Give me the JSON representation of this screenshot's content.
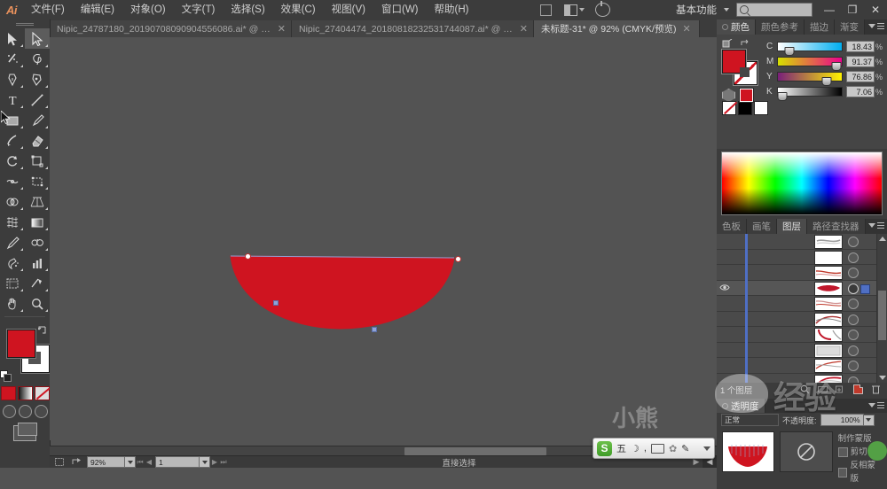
{
  "app": {
    "name": "Adobe Illustrator",
    "logo": "Ai"
  },
  "menubar": {
    "items": [
      {
        "label": "文件(F)",
        "name": "menu-file"
      },
      {
        "label": "编辑(E)",
        "name": "menu-edit"
      },
      {
        "label": "对象(O)",
        "name": "menu-object"
      },
      {
        "label": "文字(T)",
        "name": "menu-type"
      },
      {
        "label": "选择(S)",
        "name": "menu-select"
      },
      {
        "label": "效果(C)",
        "name": "menu-effect"
      },
      {
        "label": "视图(V)",
        "name": "menu-view"
      },
      {
        "label": "窗口(W)",
        "name": "menu-window"
      },
      {
        "label": "帮助(H)",
        "name": "menu-help"
      }
    ],
    "workspace": "基本功能",
    "search_placeholder": "",
    "search_value": "",
    "window_buttons": {
      "minimize": "—",
      "restore": "❐",
      "close": "✕"
    }
  },
  "tabs": [
    {
      "label": "Nipic_24787180_20190708090904556086.ai* @ 249…",
      "active": false,
      "close": "✕"
    },
    {
      "label": "Nipic_27404474_20180818232531744087.ai* @ 150…",
      "active": false,
      "close": "✕"
    },
    {
      "label": "未标题-31* @ 92% (CMYK/预览)",
      "active": true,
      "close": "✕"
    }
  ],
  "toolbar": {
    "tools": [
      {
        "name": "selection-tool",
        "label": "选择工具",
        "selected": false
      },
      {
        "name": "direct-selection-tool",
        "label": "直接选择工具",
        "selected": true
      },
      {
        "name": "magic-wand-tool",
        "label": "魔棒工具",
        "selected": false
      },
      {
        "name": "lasso-tool",
        "label": "套索工具",
        "selected": false
      },
      {
        "name": "pen-tool",
        "label": "钢笔工具",
        "selected": false
      },
      {
        "name": "curvature-tool",
        "label": "曲率工具",
        "selected": false
      },
      {
        "name": "type-tool",
        "label": "文字工具",
        "selected": false
      },
      {
        "name": "line-segment-tool",
        "label": "直线段工具",
        "selected": false
      },
      {
        "name": "rectangle-tool",
        "label": "矩形工具",
        "selected": false
      },
      {
        "name": "paintbrush-tool",
        "label": "画笔工具",
        "selected": false
      },
      {
        "name": "shaper-tool",
        "label": "Shaper 工具",
        "selected": false
      },
      {
        "name": "eraser-tool",
        "label": "橡皮擦工具",
        "selected": false
      },
      {
        "name": "rotate-tool",
        "label": "旋转工具",
        "selected": false
      },
      {
        "name": "scale-tool",
        "label": "比例缩放工具",
        "selected": false
      },
      {
        "name": "width-tool",
        "label": "宽度工具",
        "selected": false
      },
      {
        "name": "free-transform-tool",
        "label": "自由变换工具",
        "selected": false
      },
      {
        "name": "shape-builder-tool",
        "label": "形状生成器工具",
        "selected": false
      },
      {
        "name": "perspective-grid-tool",
        "label": "透视网格工具",
        "selected": false
      },
      {
        "name": "mesh-tool",
        "label": "网格工具",
        "selected": false
      },
      {
        "name": "gradient-tool",
        "label": "渐变工具",
        "selected": false
      },
      {
        "name": "eyedropper-tool",
        "label": "吸管工具",
        "selected": false
      },
      {
        "name": "blend-tool",
        "label": "混合工具",
        "selected": false
      },
      {
        "name": "symbol-sprayer-tool",
        "label": "符号喷枪工具",
        "selected": false
      },
      {
        "name": "column-graph-tool",
        "label": "柱形图工具",
        "selected": false
      },
      {
        "name": "artboard-tool",
        "label": "画板工具",
        "selected": false
      },
      {
        "name": "slice-tool",
        "label": "切片工具",
        "selected": false
      },
      {
        "name": "hand-tool",
        "label": "抓手工具",
        "selected": false
      },
      {
        "name": "zoom-tool",
        "label": "缩放工具",
        "selected": false
      }
    ],
    "fill_color": "#cf1420",
    "stroke_color": "#ffffff",
    "paint_modes": [
      "填色",
      "渐变",
      "无"
    ],
    "draw_modes": [
      "正常绘图",
      "背面绘图",
      "内部绘图"
    ],
    "screen_mode": "屏幕模式"
  },
  "canvas": {
    "shape_fill": "#cf1420",
    "zoom": "92%",
    "color_mode": "CMYK/预览"
  },
  "statusbar": {
    "zoom_value": "92%",
    "page_value": "1",
    "current_tool": "直接选择",
    "nav_first": "⏮",
    "nav_prev": "◀",
    "nav_next": "▶",
    "nav_last": "⏭"
  },
  "color_panel": {
    "tabs": [
      {
        "label": "颜色",
        "active": true,
        "name": "tab-color"
      },
      {
        "label": "颜色参考",
        "active": false,
        "name": "tab-color-guide"
      },
      {
        "label": "描边",
        "active": false,
        "name": "tab-stroke"
      },
      {
        "label": "渐变",
        "active": false,
        "name": "tab-gradient"
      }
    ],
    "channels": [
      {
        "label": "C",
        "value": "18.43",
        "unit": "%",
        "pos": 18.43,
        "from": "#ffffff",
        "to": "#00aeef"
      },
      {
        "label": "M",
        "value": "91.37",
        "unit": "%",
        "pos": 91.37,
        "from": "#d6e000",
        "to": "#ec008c"
      },
      {
        "label": "Y",
        "value": "76.86",
        "unit": "%",
        "pos": 76.86,
        "from": "#7a1f7a",
        "to": "#fff200"
      },
      {
        "label": "K",
        "value": "7.06",
        "unit": "%",
        "pos": 7.06,
        "from": "#ffffff",
        "to": "#000000"
      }
    ],
    "fill_color": "#cf1420",
    "stroke_color": "#ffffff",
    "quick_chips": [
      "无",
      "黑色",
      "白色"
    ]
  },
  "layers_panel": {
    "tabs": [
      {
        "label": "色板",
        "active": false,
        "name": "tab-swatches"
      },
      {
        "label": "画笔",
        "active": false,
        "name": "tab-brushes"
      },
      {
        "label": "图层",
        "active": true,
        "name": "tab-layers"
      },
      {
        "label": "路径查找器",
        "active": false,
        "name": "tab-pathfinder"
      }
    ],
    "rows": [
      {
        "visible": false,
        "selected": false,
        "targeted": false
      },
      {
        "visible": false,
        "selected": false,
        "targeted": false
      },
      {
        "visible": false,
        "selected": false,
        "targeted": false
      },
      {
        "visible": true,
        "selected": true,
        "targeted": true
      },
      {
        "visible": false,
        "selected": false,
        "targeted": false
      },
      {
        "visible": false,
        "selected": false,
        "targeted": false
      },
      {
        "visible": false,
        "selected": false,
        "targeted": false
      },
      {
        "visible": false,
        "selected": false,
        "targeted": false
      },
      {
        "visible": false,
        "selected": false,
        "targeted": false
      },
      {
        "visible": false,
        "selected": false,
        "targeted": false
      }
    ],
    "count_label": "1 个图层",
    "footer_icons": [
      "定位对象",
      "建立/释放剪切蒙版",
      "创建新子图层",
      "创建新图层",
      "删除所选图层"
    ]
  },
  "transparency_panel": {
    "tabs": [
      {
        "label": "透明度",
        "active": true,
        "name": "tab-transparency"
      }
    ],
    "blend_mode": "正常",
    "opacity_label": "不透明度:",
    "opacity_value": "100%",
    "options": [
      {
        "label": "剪切",
        "checked": false,
        "name": "clip-checkbox"
      },
      {
        "label": "反相蒙版",
        "checked": false,
        "name": "invert-mask-checkbox"
      }
    ],
    "make_mask_label": "制作蒙版"
  },
  "ime": {
    "logo": "S",
    "mode": "五",
    "items": [
      "moon-icon",
      "punctuation-icon",
      "keyboard-icon",
      "toolbox-icon",
      "skin-icon"
    ]
  },
  "watermark": {
    "text": "经验",
    "text2": "小熊"
  }
}
